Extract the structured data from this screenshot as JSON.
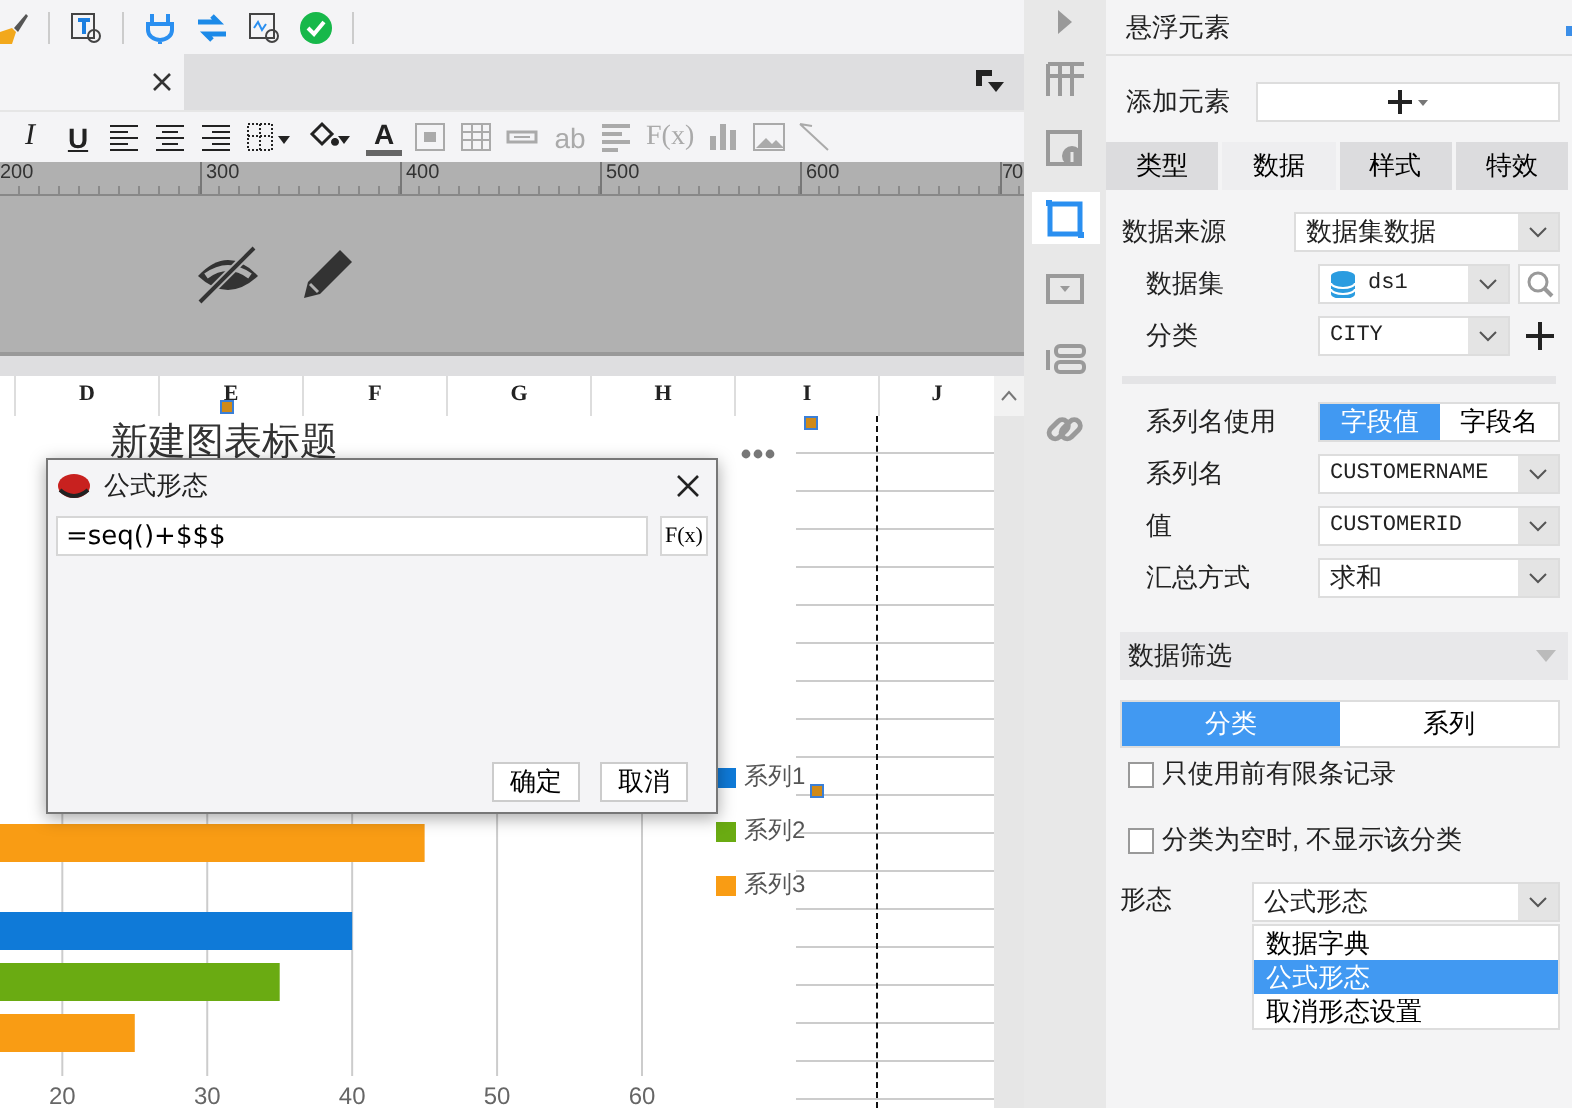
{
  "format_toolbar": [
    {
      "kind": "italic",
      "label": "I",
      "disabled": false
    },
    {
      "kind": "underline",
      "label": "U",
      "disabled": false
    },
    {
      "kind": "align-left",
      "disabled": false
    },
    {
      "kind": "align-center",
      "disabled": false
    },
    {
      "kind": "align-right",
      "disabled": false
    },
    {
      "kind": "border",
      "disabled": false
    },
    {
      "kind": "fill",
      "disabled": false
    },
    {
      "kind": "font-color",
      "label": "A",
      "disabled": false
    },
    {
      "kind": "merge",
      "disabled": true
    },
    {
      "kind": "table",
      "disabled": true
    },
    {
      "kind": "field",
      "disabled": true
    },
    {
      "kind": "text",
      "label": "ab",
      "disabled": true
    },
    {
      "kind": "paragraph",
      "disabled": true
    },
    {
      "kind": "formula",
      "label": "F(x)",
      "disabled": true
    },
    {
      "kind": "chart",
      "disabled": true
    },
    {
      "kind": "image",
      "disabled": true
    },
    {
      "kind": "slash",
      "disabled": true
    }
  ],
  "ruler": [
    "200",
    "300",
    "400",
    "500",
    "600",
    "70"
  ],
  "columns": [
    "D",
    "E",
    "F",
    "G",
    "H",
    "I",
    "J"
  ],
  "chart": {
    "title": "新建图表标题",
    "chart_data": {
      "type": "bar",
      "orientation": "horizontal",
      "grid": true,
      "legend": "right",
      "xlim": [
        15.7,
        60
      ],
      "xticks": [
        20,
        30,
        40,
        50,
        60
      ],
      "series": [
        {
          "name": "系列1",
          "color": "#0f7ad8",
          "values": [
            null,
            null,
            40
          ]
        },
        {
          "name": "系列2",
          "color": "#6aab12",
          "values": [
            null,
            null,
            35
          ]
        },
        {
          "name": "系列3",
          "color": "#f99c14",
          "values": [
            null,
            45,
            25
          ]
        }
      ]
    }
  },
  "dialog": {
    "title": "公式形态",
    "formula": "=seq()+$$$",
    "fx": "F(x)",
    "buttons": [
      "确定",
      "取消"
    ]
  },
  "side_tools": [
    {
      "kind": "layout",
      "selected": false
    },
    {
      "kind": "info",
      "selected": false
    },
    {
      "kind": "float",
      "selected": true
    },
    {
      "kind": "widget",
      "selected": false
    },
    {
      "kind": "param",
      "selected": false
    },
    {
      "kind": "link",
      "selected": false
    }
  ],
  "panel": {
    "title": "悬浮元素",
    "add_label": "添加元素",
    "tabs": [
      {
        "label": "类型",
        "selected": false
      },
      {
        "label": "数据",
        "selected": true
      },
      {
        "label": "样式",
        "selected": false
      },
      {
        "label": "特效",
        "selected": false
      }
    ],
    "data_source": {
      "label": "数据来源",
      "value": "数据集数据"
    },
    "dataset": {
      "label": "数据集",
      "value": "ds1"
    },
    "category": {
      "label": "分类",
      "value": "CITY"
    },
    "series_name_use": {
      "label": "系列名使用",
      "options": [
        {
          "label": "字段值",
          "selected": true
        },
        {
          "label": "字段名",
          "selected": false
        }
      ]
    },
    "fields": [
      {
        "label": "系列名",
        "value": "CUSTOMERNAME",
        "mono": true
      },
      {
        "label": "值",
        "value": "CUSTOMERID",
        "mono": true
      },
      {
        "label": "汇总方式",
        "value": "求和",
        "mono": false
      }
    ],
    "filter": {
      "title": "数据筛选",
      "tabs": [
        {
          "label": "分类",
          "selected": true
        },
        {
          "label": "系列",
          "selected": false
        }
      ],
      "checks": [
        {
          "label": "只使用前有限条记录",
          "checked": false
        },
        {
          "label": "分类为空时, 不显示该分类",
          "checked": false
        }
      ]
    },
    "form": {
      "label": "形态",
      "value": "公式形态",
      "options": [
        {
          "label": "数据字典",
          "selected": false
        },
        {
          "label": "公式形态",
          "selected": true
        },
        {
          "label": "取消形态设置",
          "selected": false
        }
      ]
    }
  }
}
